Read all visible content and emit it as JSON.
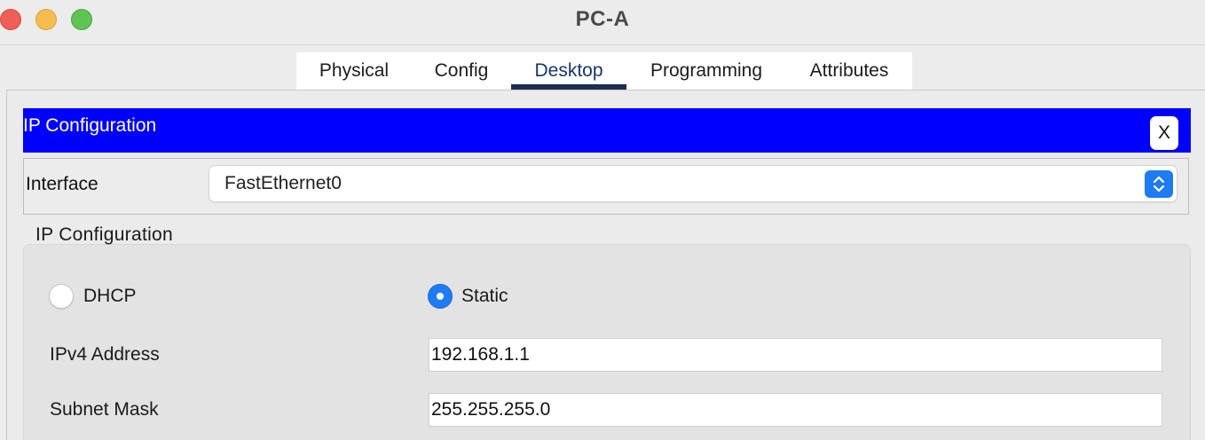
{
  "window": {
    "title": "PC-A"
  },
  "tabs": [
    {
      "label": "Physical"
    },
    {
      "label": "Config"
    },
    {
      "label": "Desktop"
    },
    {
      "label": "Programming"
    },
    {
      "label": "Attributes"
    }
  ],
  "active_tab": "Desktop",
  "ip_config": {
    "header_title": "IP Configuration",
    "close_label": "X",
    "interface_label": "Interface",
    "interface_value": "FastEthernet0",
    "group_title": "IP Configuration",
    "dhcp_label": "DHCP",
    "static_label": "Static",
    "selected_mode": "Static",
    "ipv4_label": "IPv4 Address",
    "ipv4_value": "192.168.1.1",
    "subnet_label": "Subnet Mask",
    "subnet_value": "255.255.255.0"
  },
  "colors": {
    "header_bg": "#0000ff",
    "accent": "#1e7bf2",
    "active_tab_underline": "#1b3050"
  }
}
